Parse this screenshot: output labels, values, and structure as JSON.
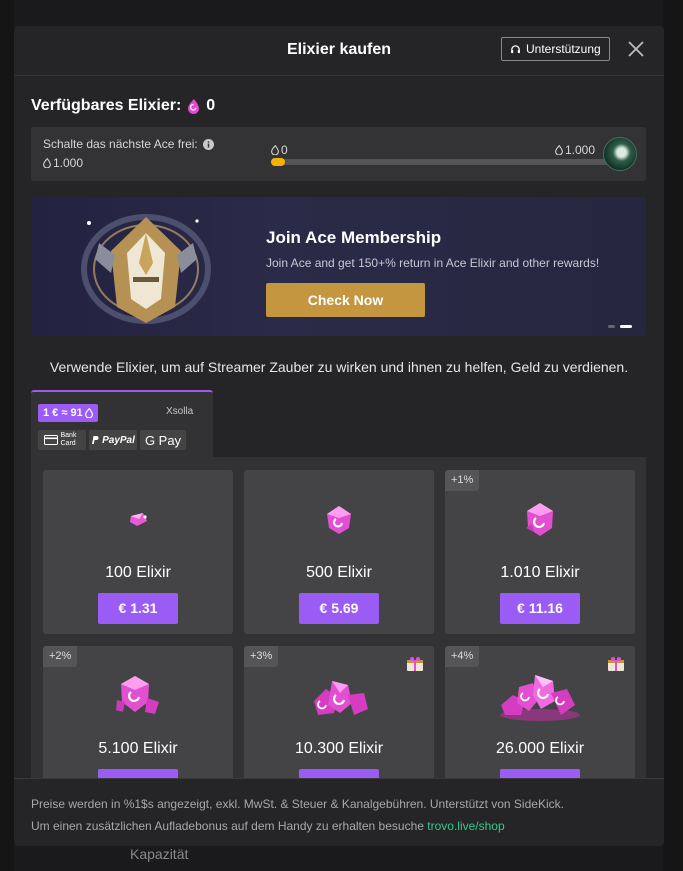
{
  "background": {
    "bottom_text": "Kapazität"
  },
  "modal": {
    "title": "Elixier kaufen",
    "support_label": "Unterstützung",
    "close_icon": "close-icon"
  },
  "balance": {
    "label": "Verfügbares Elixier:",
    "value": "0"
  },
  "unlock": {
    "label": "Schalte das nächste Ace frei:",
    "required": "1.000",
    "progress_min": "0",
    "progress_max": "1.000",
    "progress_fraction": 0.04
  },
  "banner": {
    "title": "Join Ace Membership",
    "text": "Join Ace and get 150+% return in Ace Elixir and other rewards!",
    "button": "Check Now",
    "slides": 2,
    "active_slide": 2
  },
  "description": "Verwende Elixier, um auf Streamer Zauber zu wirken und ihnen zu helfen, Geld zu verdienen.",
  "payment": {
    "rate": "1 € ≈ 91",
    "provider": "Xsolla",
    "methods": [
      "Bank Card",
      "PayPal",
      "G Pay"
    ]
  },
  "packages": [
    {
      "name": "100 Elixir",
      "price": "€ 1.31",
      "bonus": "",
      "gift": false
    },
    {
      "name": "500 Elixir",
      "price": "€ 5.69",
      "bonus": "",
      "gift": false
    },
    {
      "name": "1.010 Elixir",
      "price": "€ 11.16",
      "bonus": "+1%",
      "gift": false
    },
    {
      "name": "5.100 Elixir",
      "price": "",
      "bonus": "+2%",
      "gift": false
    },
    {
      "name": "10.300 Elixir",
      "price": "",
      "bonus": "+3%",
      "gift": true
    },
    {
      "name": "26.000 Elixir",
      "price": "",
      "bonus": "+4%",
      "gift": true
    }
  ],
  "footer": {
    "line1": "Preise werden in %1$s angezeigt, exkl. MwSt. & Steuer & Kanalgebühren. Unterstützt von SideKick.",
    "line2": "Um einen zusätzlichen Aufladebonus auf dem Handy zu erhalten besuche ",
    "link": "trovo.live/shop"
  },
  "colors": {
    "accent": "#9b5cf6",
    "gold": "#c4963f",
    "progress": "#f5b301",
    "elixir": "#e64ad3",
    "link": "#34c98a"
  }
}
